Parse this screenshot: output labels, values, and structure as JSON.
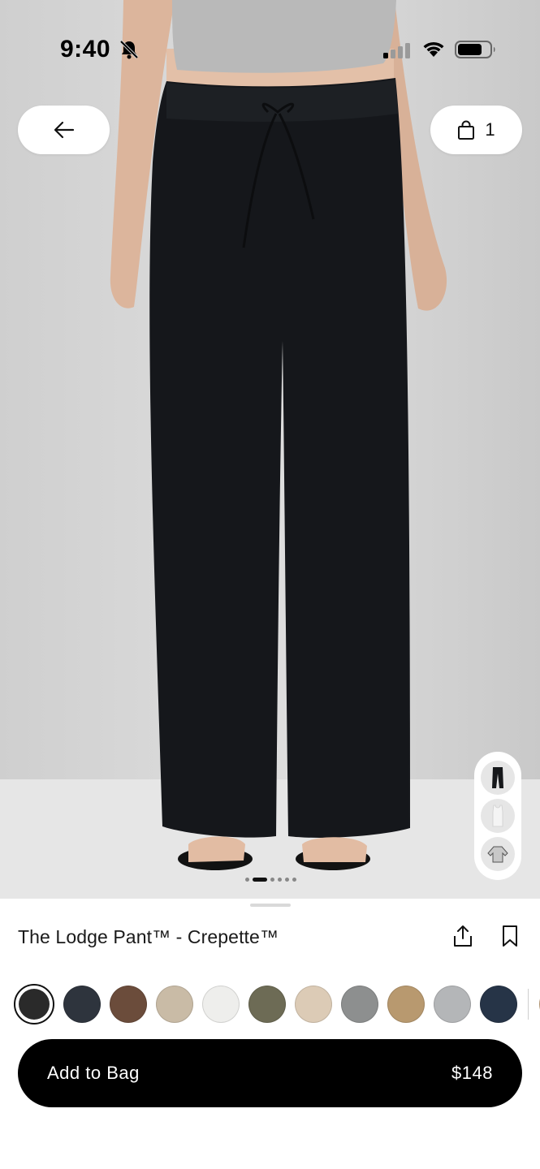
{
  "status_bar": {
    "time": "9:40",
    "icons": [
      "bell-slash-icon",
      "signal-icon",
      "wifi-icon",
      "battery-icon"
    ]
  },
  "header": {
    "back_icon": "arrow-left-icon",
    "bag_icon": "shopping-bag-icon",
    "bag_count": "1"
  },
  "gallery": {
    "page_count": 6,
    "active_index": 1,
    "thumbnails": [
      "pants-thumbnail",
      "tank-top-thumbnail",
      "sweater-thumbnail"
    ]
  },
  "product": {
    "title": "The Lodge Pant™ - Crepette™",
    "share_icon": "share-icon",
    "bookmark_icon": "bookmark-icon"
  },
  "colors": {
    "selected_index": 0,
    "swatches": [
      "#2a2a2a",
      "#2e343d",
      "#6b4c3b",
      "#c9bba6",
      "#eeeeec",
      "#6d6b55",
      "#dccbb6",
      "#8d8f8f",
      "#b8996f",
      "#b4b6b8",
      "#263447",
      "#c7a57e"
    ]
  },
  "cta": {
    "label": "Add to Bag",
    "price": "$148",
    "background": "#000000"
  }
}
